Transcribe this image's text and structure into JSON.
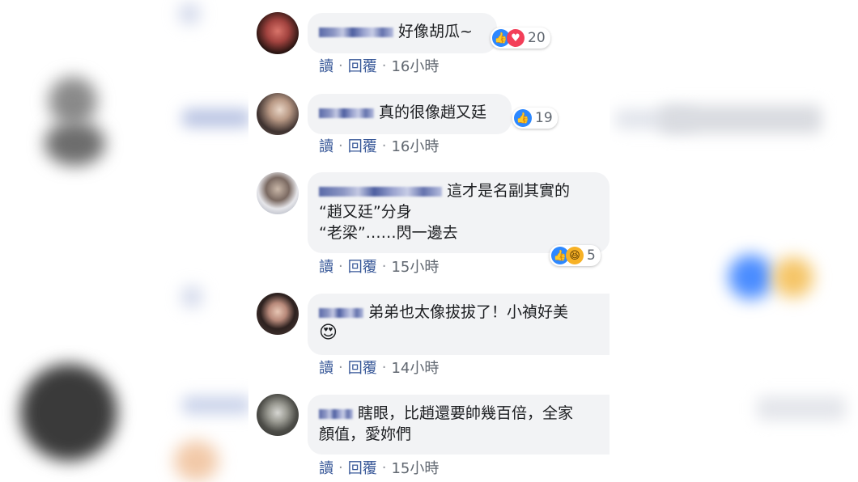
{
  "colors": {
    "bubble": "#f2f3f5",
    "link": "#385898",
    "meta": "#606770",
    "like": "#2d88ff",
    "love": "#f33e58",
    "haha": "#f7b125"
  },
  "meta": {
    "read_label": "讀",
    "reply_label": "回覆",
    "separator": "·"
  },
  "comments": [
    {
      "text": "好像胡瓜~",
      "reactions": [
        "like-icon",
        "love-icon"
      ],
      "reaction_count": "20",
      "time": "16小時"
    },
    {
      "text": "真的很像趙又廷",
      "reactions": [
        "like-icon"
      ],
      "reaction_count": "19",
      "time": "16小時"
    },
    {
      "line1": "這才是名副其實的",
      "line2": "“趙又廷”分身",
      "line3": "“老梁”……閃一邊去",
      "reactions": [
        "like-icon",
        "haha-icon"
      ],
      "reaction_count": "5",
      "time": "15小時"
    },
    {
      "text": "弟弟也太像拔拔了！小禎好美",
      "emoji": "😍",
      "time": "14小時"
    },
    {
      "line1": "瞎眼，比趙還要帥幾百倍，全家",
      "line2": "顏值，愛妳們",
      "time": "15小時"
    }
  ]
}
